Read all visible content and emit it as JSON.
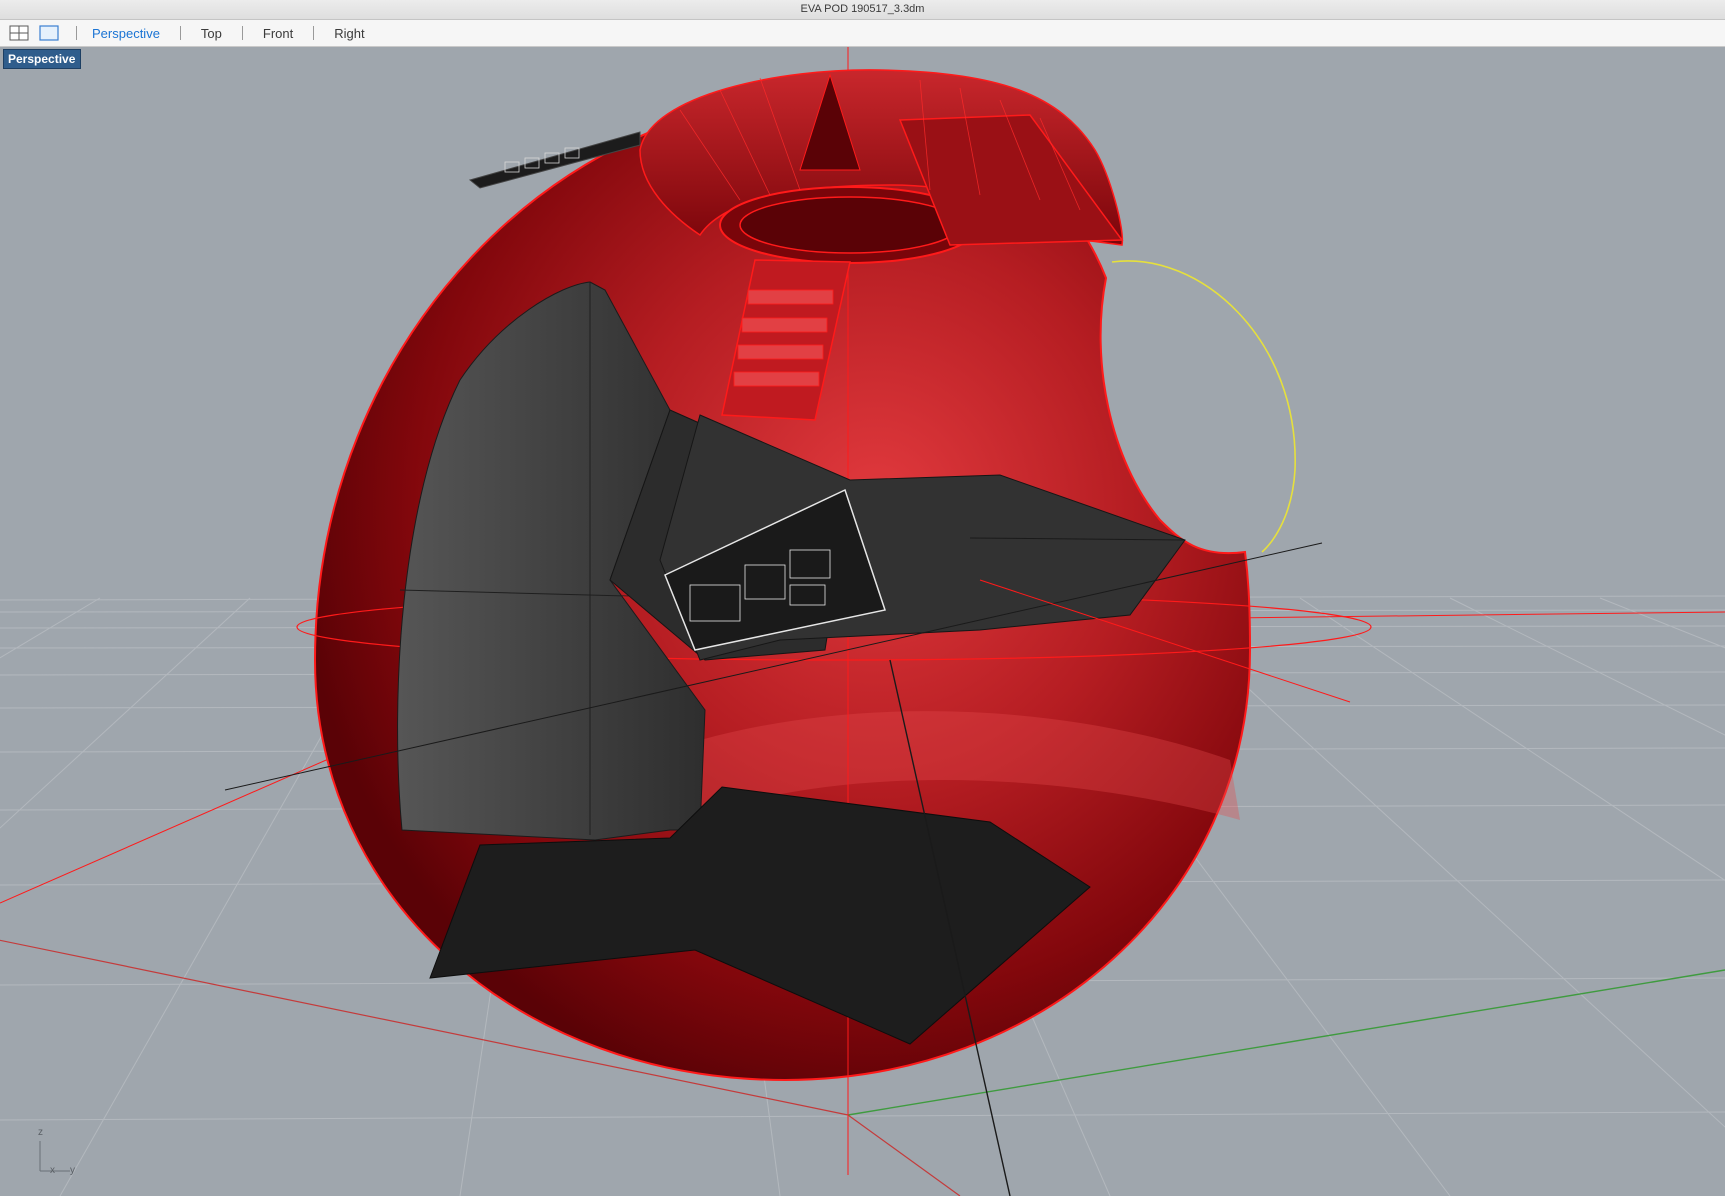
{
  "window": {
    "title": "EVA POD 190517_3.3dm"
  },
  "toolbar": {
    "layout_buttons": [
      {
        "name": "four-viewports-icon"
      },
      {
        "name": "single-viewport-icon"
      }
    ],
    "tabs": [
      {
        "label": "Perspective",
        "active": true
      },
      {
        "label": "Top",
        "active": false
      },
      {
        "label": "Front",
        "active": false
      },
      {
        "label": "Right",
        "active": false
      }
    ]
  },
  "viewport": {
    "label": "Perspective",
    "axis_labels": {
      "z": "z",
      "x": "x",
      "y": "y"
    }
  },
  "colors": {
    "accent": "#1b74d4",
    "viewport_bg": "#9fa6ad",
    "selection": "#ff1a1a",
    "x_axis": "#c43b3b",
    "y_axis": "#3f9b3f",
    "curve": "#e6e03c"
  }
}
